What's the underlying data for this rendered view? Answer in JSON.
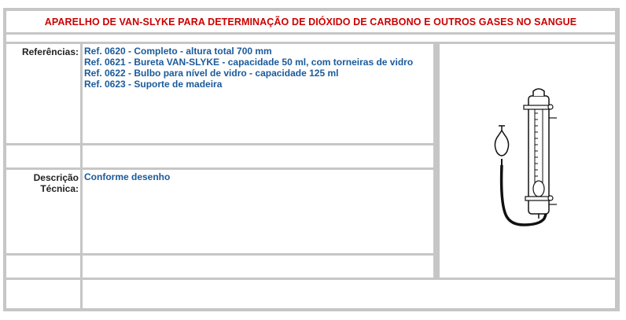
{
  "title": "APARELHO DE VAN-SLYKE PARA DETERMINAÇÃO DE DIÓXIDO DE CARBONO E OUTROS GASES NO SANGUE",
  "references": {
    "label": "Referências:",
    "items": [
      "Ref. 0620 - Completo - altura total 700 mm",
      "Ref. 0621 - Bureta VAN-SLYKE - capacidade 50 ml, com torneiras de vidro",
      "Ref. 0622 - Bulbo para nível de vidro - capacidade 125 ml",
      "Ref. 0623 - Suporte de madeira"
    ]
  },
  "description": {
    "label_line1": "Descrição",
    "label_line2": "Técnica:",
    "value": "Conforme desenho"
  },
  "image": {
    "icon": "van-slyke-apparatus-drawing"
  },
  "colors": {
    "title": "#cc0000",
    "value": "#1a5a9a",
    "border": "#c6c6c6"
  }
}
